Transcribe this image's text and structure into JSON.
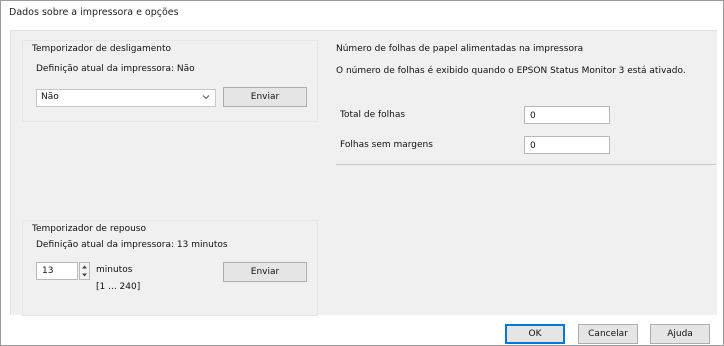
{
  "window": {
    "title": "Dados sobre a impressora e opções"
  },
  "shutdown_timer": {
    "group_label": "Temporizador de desligamento",
    "current_setting": "Definição atual da impressora: Não",
    "dropdown_value": "Não",
    "send_label": "Enviar"
  },
  "sleep_timer": {
    "group_label": "Temporizador de repouso",
    "current_setting": "Definição atual da impressora: 13 minutos",
    "value": "13",
    "unit": "minutos",
    "range": "[1 ... 240]",
    "send_label": "Enviar"
  },
  "sheets": {
    "group_label": "Número de folhas de papel alimentadas na impressora",
    "info": "O número de folhas é exibido quando o EPSON Status Monitor 3 está ativado.",
    "total_label": "Total de folhas",
    "total_value": "0",
    "borderless_label": "Folhas sem margens",
    "borderless_value": "0"
  },
  "footer": {
    "ok_label": "OK",
    "cancel_label": "Cancelar",
    "help_label": "Ajuda"
  },
  "icons": {
    "dropdown": "chevron-down-icon",
    "spin_up": "triangle-up-icon",
    "spin_down": "triangle-down-icon"
  }
}
